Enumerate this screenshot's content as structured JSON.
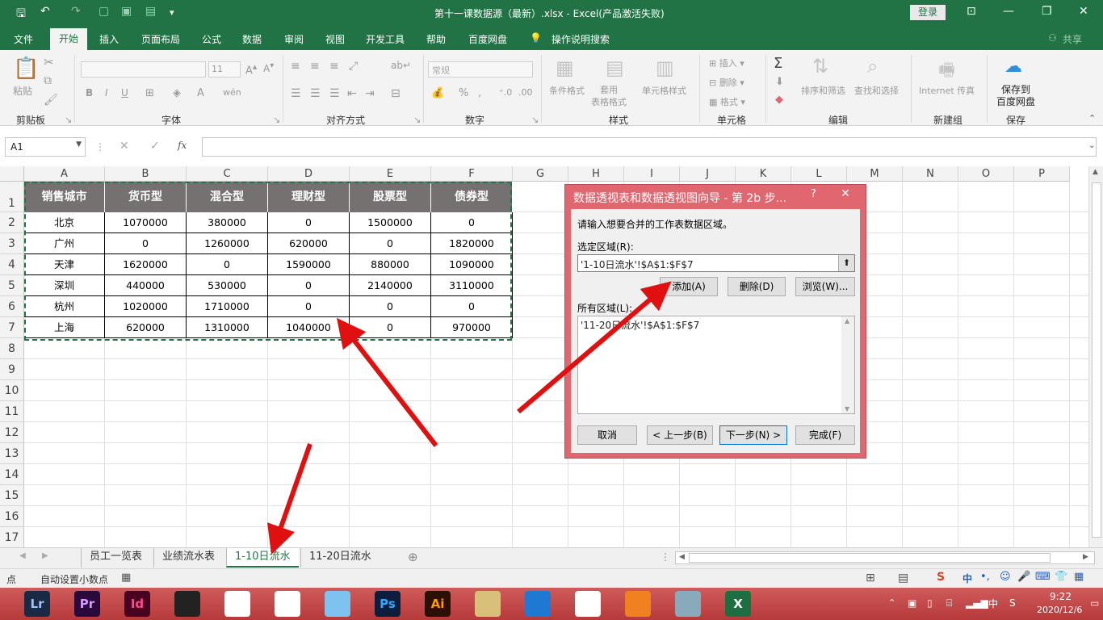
{
  "title_bar": {
    "title": "第十一课数据源（最新）.xlsx  -  Excel(产品激活失败)",
    "login": "登录"
  },
  "menu": {
    "file": "文件",
    "home": "开始",
    "insert": "插入",
    "layout": "页面布局",
    "formula": "公式",
    "data": "数据",
    "review": "审阅",
    "view": "视图",
    "dev": "开发工具",
    "help": "帮助",
    "baidu": "百度网盘",
    "tell": "操作说明搜索",
    "share": "共享"
  },
  "ribbon": {
    "clipboard": "剪贴板",
    "paste": "粘贴",
    "font": "字体",
    "font_size": "11",
    "align": "对齐方式",
    "number": "数字",
    "number_format": "常规",
    "styles": "样式",
    "cond_format": "条件格式",
    "table_format": "套用\n表格格式",
    "cell_styles": "单元格样式",
    "cells": "单元格",
    "insert": "插入",
    "delete": "删除",
    "format": "格式",
    "editing": "编辑",
    "sort_filter": "排序和筛选",
    "find_select": "查找和选择",
    "new_group": "新建组",
    "internet_fax": "Internet 传真",
    "save": "保存",
    "save_baidu": "保存到\n百度网盘"
  },
  "formula_bar": {
    "namebox": "A1",
    "fx": "fx"
  },
  "columns": [
    "A",
    "B",
    "C",
    "D",
    "E",
    "F",
    "G",
    "H",
    "I",
    "J",
    "K",
    "L",
    "M",
    "N",
    "O",
    "P"
  ],
  "rows": [
    "1",
    "2",
    "3",
    "4",
    "5",
    "6",
    "7",
    "8",
    "9",
    "10",
    "11",
    "12",
    "13",
    "14",
    "15",
    "16",
    "17"
  ],
  "table": {
    "headers": [
      "销售城市",
      "货币型",
      "混合型",
      "理财型",
      "股票型",
      "债券型"
    ],
    "rows": [
      [
        "北京",
        "1070000",
        "380000",
        "0",
        "1500000",
        "0"
      ],
      [
        "广州",
        "0",
        "1260000",
        "620000",
        "0",
        "1820000"
      ],
      [
        "天津",
        "1620000",
        "0",
        "1590000",
        "880000",
        "1090000"
      ],
      [
        "深圳",
        "440000",
        "530000",
        "0",
        "2140000",
        "3110000"
      ],
      [
        "杭州",
        "1020000",
        "1710000",
        "0",
        "0",
        "0"
      ],
      [
        "上海",
        "620000",
        "1310000",
        "1040000",
        "0",
        "970000"
      ]
    ]
  },
  "sheets": [
    "员工一览表",
    "业绩流水表",
    "1-10日流水",
    "11-20日流水"
  ],
  "active_sheet": "1-10日流水",
  "status": {
    "mode": "点",
    "auto_decimal": "自动设置小数点"
  },
  "dialog": {
    "title": "数据透视表和数据透视图向导 - 第 2b 步...",
    "help": "?",
    "instruction": "请输入想要合并的工作表数据区域。",
    "selected_label": "选定区域(R):",
    "selected_value": "'1-10日流水'!$A$1:$F$7",
    "add": "添加(A)",
    "delete": "删除(D)",
    "browse": "浏览(W)...",
    "all_label": "所有区域(L):",
    "all_items": [
      "'11-20日流水'!$A$1:$F$7"
    ],
    "cancel": "取消",
    "back": "< 上一步(B)",
    "next": "下一步(N) >",
    "finish": "完成(F)"
  },
  "taskbar": {
    "time": "9:22",
    "date": "2020/12/6",
    "ime": "中",
    "apps": [
      "Lr",
      "Pr",
      "Id",
      "",
      "",
      "",
      "",
      "Ps",
      "Ai",
      "",
      "",
      "",
      "",
      "",
      "X"
    ]
  },
  "colors": {
    "excel_green": "#217346",
    "header_gray": "#757171",
    "dialog_border": "#e06670",
    "arrow": "#e01010"
  }
}
